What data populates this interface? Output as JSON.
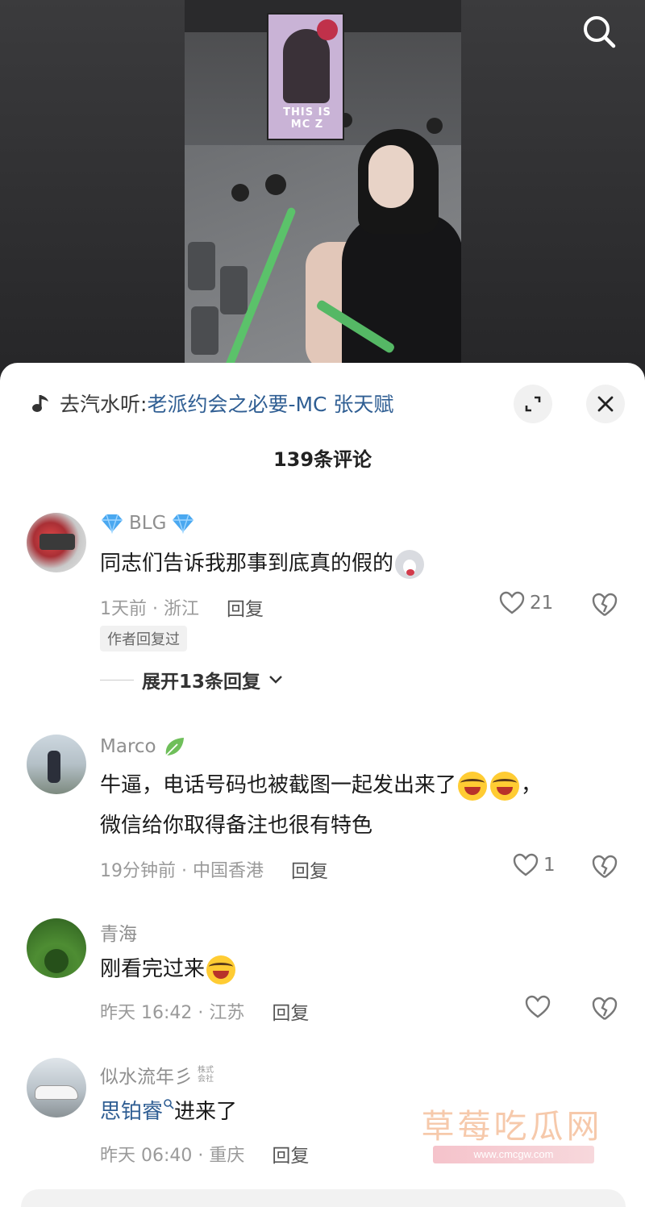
{
  "video": {
    "banner_text": "THIS IS MC Z"
  },
  "music": {
    "prefix": "去汽水听:",
    "title": "老派约会之必要-MC 张天赋"
  },
  "comments_header": {
    "title": "139条评论"
  },
  "comments": [
    {
      "username": "BLG",
      "username_badge": "diamond-icon",
      "text": "同志们告诉我那事到底真的假的",
      "emoji": "husky-emoji",
      "time_location": "1天前 · 浙江",
      "reply_label": "回复",
      "likes": "21",
      "author_badge": "作者回复过",
      "expand_label": "展开13条回复"
    },
    {
      "username": "Marco",
      "username_badge": "leaf-icon",
      "text_line1": "牛逼，电话号码也被截图一起发出来了",
      "text_line1_tail": "，",
      "text_line2": "微信给你取得备注也很有特色",
      "emoji": "laughing-crying-emoji",
      "time_location": "19分钟前 · 中国香港",
      "reply_label": "回复",
      "likes": "1"
    },
    {
      "username": "青海",
      "text": "刚看完过来",
      "emoji": "laughing-crying-emoji",
      "time_location": "昨天 16:42 · 江苏",
      "reply_label": "回复",
      "likes": ""
    },
    {
      "username": "似水流年彡",
      "username_suffix": "株式会社",
      "mention": "思铂睿",
      "text": "进来了",
      "time_location": "昨天 06:40 · 重庆",
      "reply_label": "回复"
    }
  ],
  "watermark": {
    "title": "草莓吃瓜网",
    "url": "www.cmcgw.com"
  },
  "colors": {
    "link_blue": "#2f5e93",
    "meta_gray": "#9a9a9a",
    "sheet_bg": "#ffffff"
  }
}
